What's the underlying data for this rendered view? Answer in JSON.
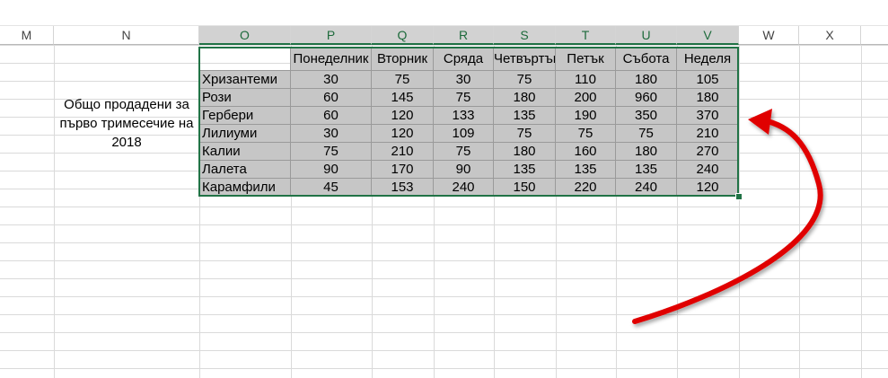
{
  "columns": [
    "M",
    "N",
    "O",
    "P",
    "Q",
    "R",
    "S",
    "T",
    "U",
    "V",
    "W",
    "X"
  ],
  "note": "Общо продадени за първо тримесечие на 2018",
  "table": {
    "headers": [
      "Понеделник",
      "Вторник",
      "Сряда",
      "Четвъртък",
      "Петък",
      "Събота",
      "Неделя"
    ],
    "rows": [
      {
        "label": "Хризантеми",
        "values": [
          30,
          75,
          30,
          75,
          110,
          180,
          105
        ]
      },
      {
        "label": "Рози",
        "values": [
          60,
          145,
          75,
          180,
          200,
          960,
          180
        ]
      },
      {
        "label": "Гербери",
        "values": [
          60,
          120,
          133,
          135,
          190,
          350,
          370
        ]
      },
      {
        "label": "Лилиуми",
        "values": [
          30,
          120,
          109,
          75,
          75,
          75,
          210
        ]
      },
      {
        "label": "Калии",
        "values": [
          75,
          210,
          75,
          180,
          160,
          180,
          270
        ]
      },
      {
        "label": "Лалета",
        "values": [
          90,
          170,
          90,
          135,
          135,
          135,
          240
        ]
      },
      {
        "label": "Карамфили",
        "values": [
          45,
          153,
          240,
          150,
          220,
          240,
          120
        ]
      }
    ]
  },
  "colors": {
    "selection_border": "#217346",
    "table_fill": "#c6c6c6",
    "arrow": "#e00000"
  }
}
